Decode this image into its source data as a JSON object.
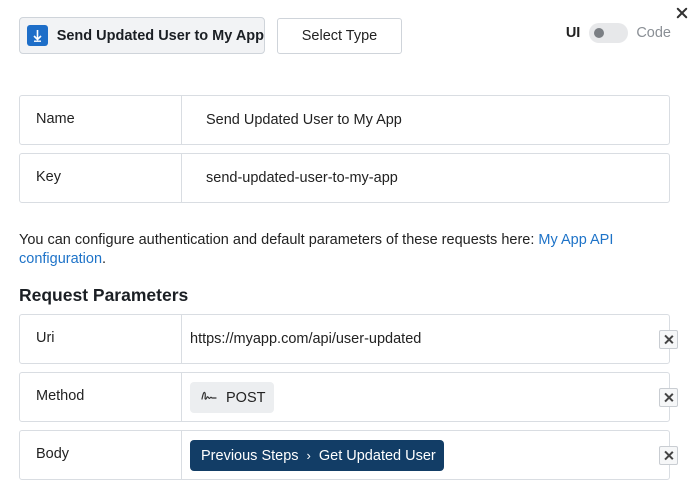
{
  "header": {
    "step_title": "Send Updated User to My App",
    "select_type_label": "Select Type",
    "toggle": {
      "left_label": "UI",
      "right_label": "Code",
      "mode": "UI"
    }
  },
  "fields": {
    "name": {
      "label": "Name",
      "value": "Send Updated User to My App"
    },
    "key": {
      "label": "Key",
      "value": "send-updated-user-to-my-app"
    }
  },
  "info": {
    "text": "You can configure authentication and default parameters of these requests here: ",
    "link": "My App API configuration",
    "suffix": "."
  },
  "request_parameters": {
    "title": "Request Parameters",
    "uri": {
      "label": "Uri",
      "value": "https://myapp.com/api/user-updated"
    },
    "method": {
      "label": "Method",
      "value": "POST"
    },
    "body": {
      "label": "Body",
      "path": [
        "Previous Steps",
        "Get Updated User"
      ]
    }
  },
  "colors": {
    "step_icon": "#1e6ec8",
    "link": "#1e73c8",
    "body_chip": "#123d66"
  },
  "icons": [
    "close-icon",
    "download-arrow-icon",
    "signature-icon",
    "chevron-right-icon",
    "remove-icon"
  ]
}
